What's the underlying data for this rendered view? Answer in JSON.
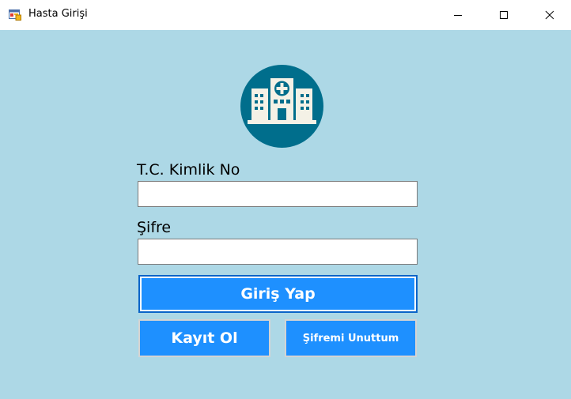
{
  "window": {
    "title": "Hasta Girişi",
    "icon": "winforms-app-icon",
    "controls": [
      "minimize-icon",
      "maximize-icon",
      "close-icon"
    ]
  },
  "form": {
    "background_color": "#add8e6",
    "logo_icon": "hospital-building-icon",
    "logo_color": "#006e8c",
    "tc_label": "T.C. Kimlik No",
    "tc_value": "",
    "password_label": "Şifre",
    "password_value": "",
    "login_button": "Giriş Yap",
    "register_button": "Kayıt Ol",
    "forgot_button": "Şifremi Unuttum",
    "button_color": "#1e90ff"
  }
}
